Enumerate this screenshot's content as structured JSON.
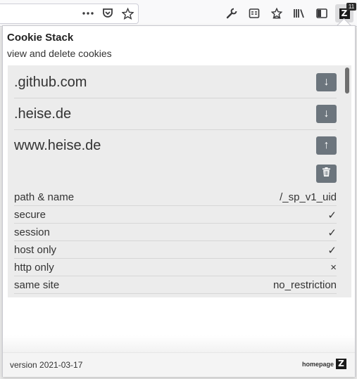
{
  "toolbar": {
    "icons": [
      "more-actions-icon",
      "pocket-icon",
      "bookmark-star-icon",
      "wrench-icon",
      "reader-view-icon",
      "whats-new-icon",
      "library-icon",
      "sidebar-icon",
      "cookie-stack-extension-icon"
    ],
    "extension_letter": "Z",
    "extension_badge": "11"
  },
  "popup": {
    "title": "Cookie Stack",
    "subtitle": "view and delete cookies",
    "domains": [
      {
        "name": ".github.com",
        "expanded": false,
        "toggle_icon": "↓"
      },
      {
        "name": ".heise.de",
        "expanded": false,
        "toggle_icon": "↓"
      },
      {
        "name": "www.heise.de",
        "expanded": true,
        "toggle_icon": "↑"
      }
    ],
    "cookie_details": [
      {
        "key": "path & name",
        "value": "/_sp_v1_uid"
      },
      {
        "key": "secure",
        "value": "✓"
      },
      {
        "key": "session",
        "value": "✓"
      },
      {
        "key": "host only",
        "value": "✓"
      },
      {
        "key": "http only",
        "value": "×"
      },
      {
        "key": "same site",
        "value": "no_restriction"
      }
    ],
    "footer": {
      "version": "version 2021-03-17",
      "homepage_label": "homepage",
      "homepage_logo": "Z"
    }
  },
  "colors": {
    "button_bg": "#6c757d",
    "list_bg": "#ececec",
    "scroll_thumb": "#6e6e6e"
  }
}
